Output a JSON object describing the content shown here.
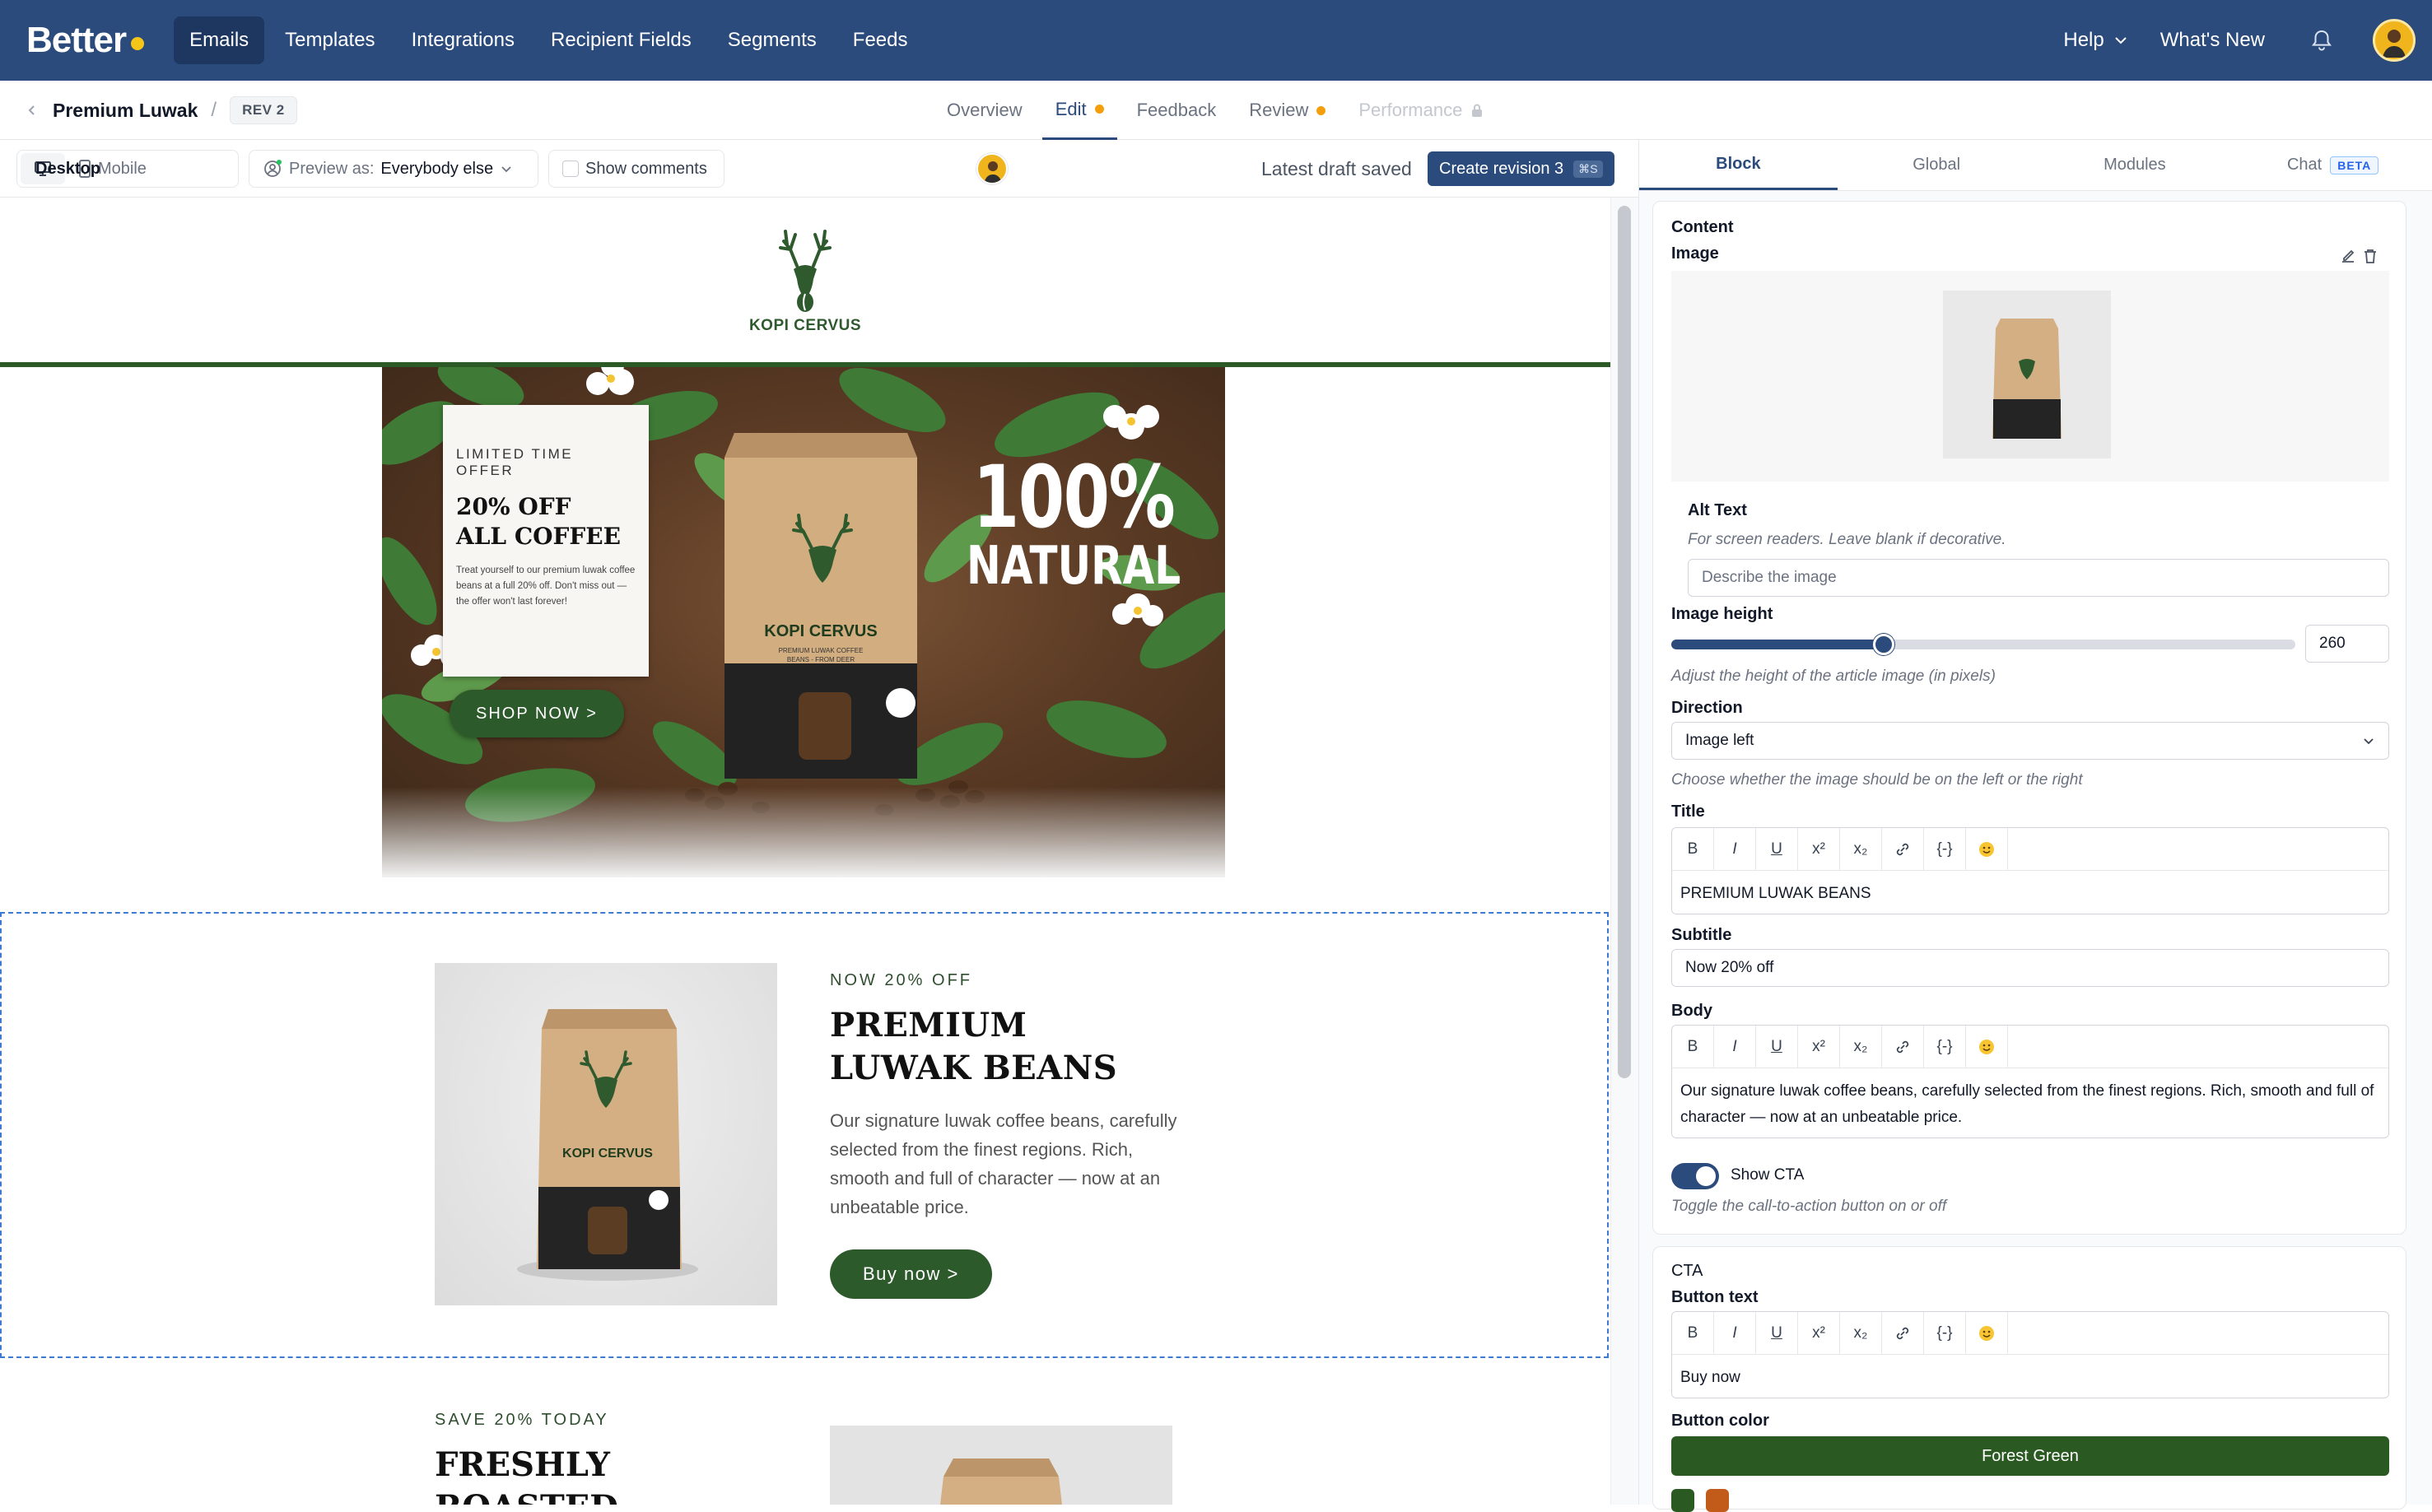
{
  "app": {
    "brand": "Better"
  },
  "nav": {
    "items": [
      "Emails",
      "Templates",
      "Integrations",
      "Recipient Fields",
      "Segments",
      "Feeds"
    ],
    "help": "Help",
    "whats_new": "What's New"
  },
  "breadcrumb": {
    "title": "Premium Luwak",
    "separator": "/",
    "revision": "REV 2"
  },
  "tabs": {
    "overview": "Overview",
    "edit": "Edit",
    "feedback": "Feedback",
    "review": "Review",
    "performance": "Performance"
  },
  "toolbar": {
    "desktop": "Desktop",
    "mobile": "Mobile",
    "preview_label": "Preview as:",
    "preview_value": "Everybody else",
    "show_comments": "Show comments",
    "draft_status": "Latest draft saved",
    "create_revision": "Create revision 3",
    "shortcut": "⌘S"
  },
  "email": {
    "brand_name": "KOPI CERVUS",
    "hero": {
      "kicker": "LIMITED TIME OFFER",
      "title_line1": "20% OFF",
      "title_line2": "ALL COFFEE",
      "body": "Treat yourself to our premium luwak coffee beans at a full 20% off. Don't miss out — the offer won't last forever!",
      "cta": "SHOP NOW >",
      "big_number": "100%",
      "big_word": "NATURAL",
      "bag_brand": "KOPI CERVUS",
      "bag_sub": "PREMIUM LUWAK COFFEE BEANS - FROM DEER"
    },
    "article": {
      "kicker": "NOW 20% OFF",
      "title_line1": "PREMIUM",
      "title_line2": "LUWAK BEANS",
      "body": "Our signature luwak coffee beans, carefully selected from the finest regions. Rich, smooth and full of character — now at an unbeatable price.",
      "cta": "Buy now >"
    },
    "next": {
      "kicker": "SAVE 20% TODAY",
      "title_line1": "FRESHLY",
      "title_line2": "ROASTED"
    }
  },
  "panel": {
    "tabs": {
      "block": "Block",
      "global": "Global",
      "modules": "Modules",
      "chat": "Chat",
      "beta": "BETA"
    },
    "content_heading": "Content",
    "image_label": "Image",
    "alt_text_label": "Alt Text",
    "alt_text_hint": "For screen readers. Leave blank if decorative.",
    "alt_text_placeholder": "Describe the image",
    "image_height_label": "Image height",
    "image_height_value": "260",
    "image_height_fraction": 0.34,
    "image_height_hint": "Adjust the height of the article image (in pixels)",
    "direction_label": "Direction",
    "direction_value": "Image left",
    "direction_hint": "Choose whether the image should be on the left or the right",
    "title_label": "Title",
    "title_value": "PREMIUM LUWAK BEANS",
    "subtitle_label": "Subtitle",
    "subtitle_value": "Now 20% off",
    "body_label": "Body",
    "body_value": "Our signature luwak coffee beans, carefully selected from the finest regions. Rich, smooth and full of character — now at an unbeatable price.",
    "show_cta_label": "Show CTA",
    "show_cta_hint": "Toggle the call-to-action button on or off",
    "cta_heading": "CTA",
    "button_text_label": "Button text",
    "button_text_value": "Buy now",
    "button_color_label": "Button color",
    "button_color_value": "Forest Green",
    "editor_tools": [
      "B",
      "I",
      "U",
      "x²",
      "x₂",
      "link",
      "{-}",
      "emoji"
    ]
  },
  "colors": {
    "nav": "#2b4b7c",
    "accent": "#2b4b7c",
    "brand_green": "#2d5a2b",
    "forest_green": "#2a5a22",
    "swatch_orange": "#c25b1a",
    "status_orange": "#f59e0b",
    "logo_dot": "#f5c518"
  }
}
